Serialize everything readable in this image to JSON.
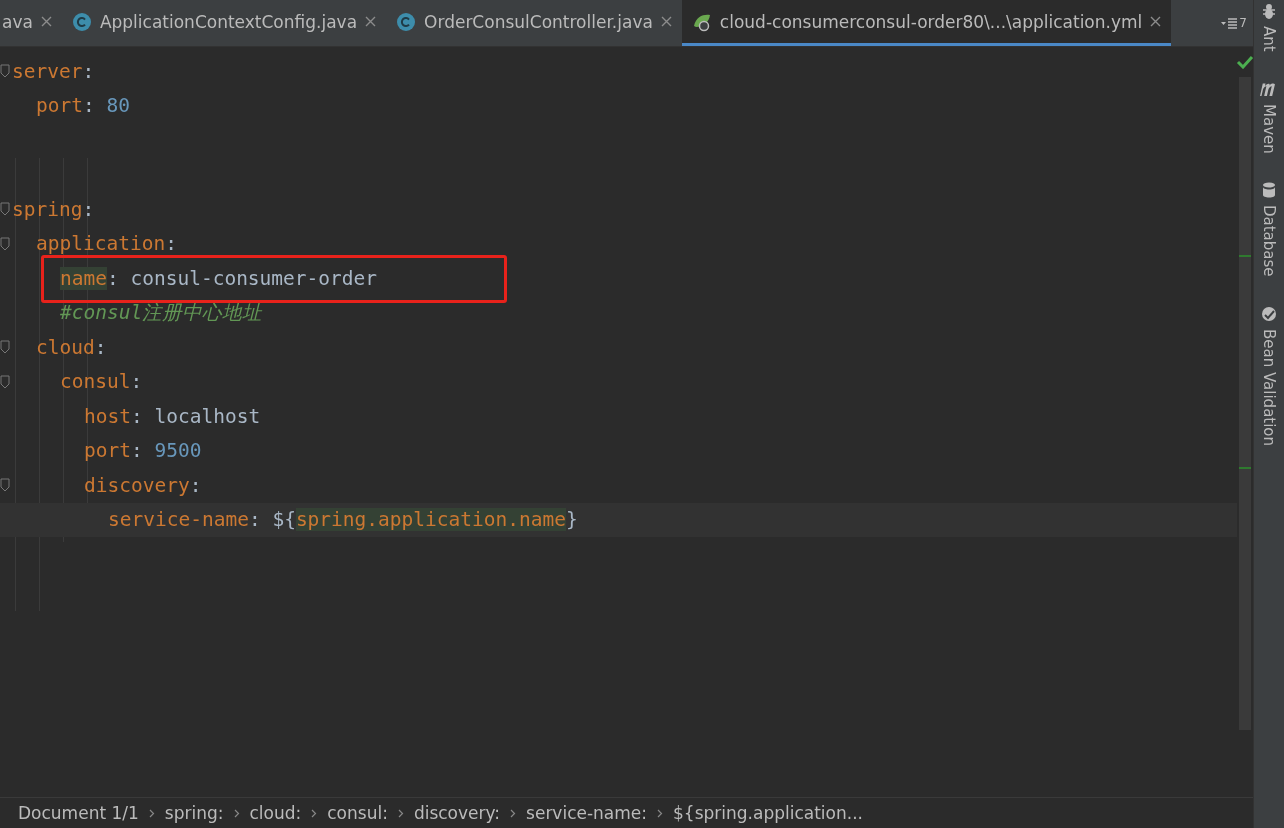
{
  "tabs": [
    {
      "label": "ava",
      "kind": "plain",
      "selected": false
    },
    {
      "label": "ApplicationContextConfig.java",
      "kind": "class",
      "selected": false
    },
    {
      "label": "OrderConsulController.java",
      "kind": "class",
      "selected": false
    },
    {
      "label": "cloud-consumerconsul-order80\\...\\application.yml",
      "kind": "yaml",
      "selected": true
    }
  ],
  "tab_overflow_count": "7",
  "editor": {
    "lines": [
      {
        "kind": "section",
        "key": "server",
        "sep": ":",
        "children": [
          {
            "kind": "number",
            "key": "port",
            "sep": ":",
            "value": "80"
          }
        ]
      },
      {
        "kind": "blank"
      },
      {
        "kind": "blank"
      },
      {
        "kind": "section",
        "key": "spring",
        "sep": ":",
        "children": [
          {
            "kind": "section",
            "key": "application",
            "sep": ":",
            "children": [
              {
                "kind": "text",
                "key": "name",
                "sep": ":",
                "value": "consul-consumer-order",
                "key_highlighted": true,
                "annotated": true
              },
              {
                "kind": "comment",
                "text": "#consul注册中心地址"
              }
            ]
          },
          {
            "kind": "section",
            "key": "cloud",
            "sep": ":",
            "children": [
              {
                "kind": "section",
                "key": "consul",
                "sep": ":",
                "children": [
                  {
                    "kind": "text",
                    "key": "host",
                    "sep": ":",
                    "value": "localhost"
                  },
                  {
                    "kind": "number",
                    "key": "port",
                    "sep": ":",
                    "value": "9500"
                  },
                  {
                    "kind": "section",
                    "key": "discovery",
                    "sep": ":",
                    "children": [
                      {
                        "kind": "reference",
                        "key": "service-name",
                        "sep": ":",
                        "value_prefix": "${",
                        "value": "spring.application.name",
                        "value_suffix": "}",
                        "value_highlighted": true,
                        "current": true
                      }
                    ]
                  }
                ]
              }
            ]
          }
        ]
      }
    ]
  },
  "side_tools": [
    {
      "label": "Ant",
      "kind": "ant"
    },
    {
      "label": "Maven",
      "kind": "maven"
    },
    {
      "label": "Database",
      "kind": "database"
    },
    {
      "label": "Bean Validation",
      "kind": "bean"
    }
  ],
  "breadcrumbs": [
    "Document 1/1",
    "spring:",
    "cloud:",
    "consul:",
    "discovery:",
    "service-name:",
    "${spring.application..."
  ]
}
